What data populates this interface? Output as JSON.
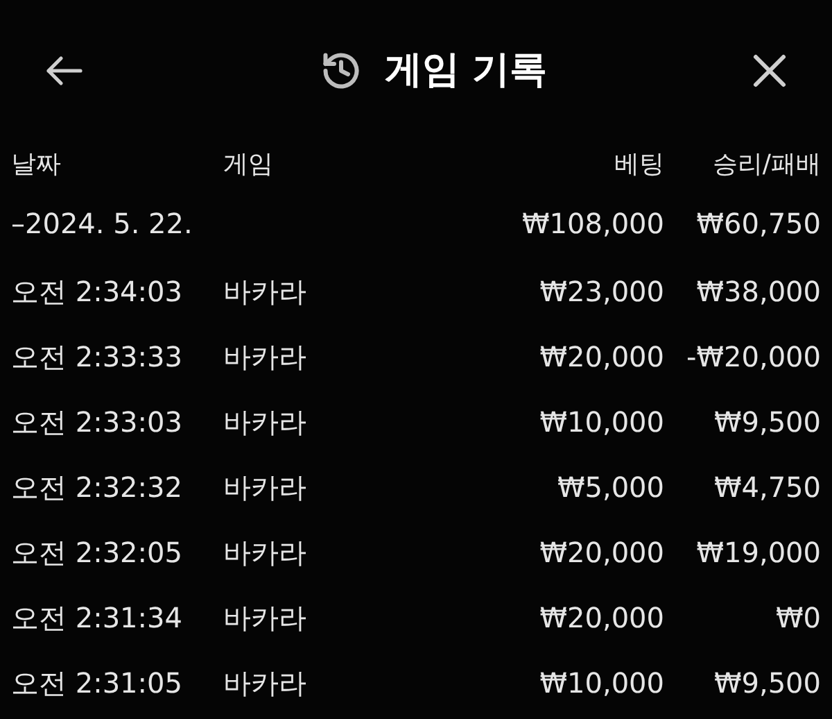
{
  "header": {
    "title": "게임 기록"
  },
  "table": {
    "columns": [
      "날짜",
      "게임",
      "베팅",
      "승리/패배"
    ],
    "summary": {
      "date": "–2024. 5. 22.",
      "bet": "₩108,000",
      "result": "₩60,750"
    },
    "rows": [
      {
        "time": "오전 2:34:03",
        "game": "바카라",
        "bet": "₩23,000",
        "result": "₩38,000"
      },
      {
        "time": "오전 2:33:33",
        "game": "바카라",
        "bet": "₩20,000",
        "result": "-₩20,000"
      },
      {
        "time": "오전 2:33:03",
        "game": "바카라",
        "bet": "₩10,000",
        "result": "₩9,500"
      },
      {
        "time": "오전 2:32:32",
        "game": "바카라",
        "bet": "₩5,000",
        "result": "₩4,750"
      },
      {
        "time": "오전 2:32:05",
        "game": "바카라",
        "bet": "₩20,000",
        "result": "₩19,000"
      },
      {
        "time": "오전 2:31:34",
        "game": "바카라",
        "bet": "₩20,000",
        "result": "₩0"
      },
      {
        "time": "오전 2:31:05",
        "game": "바카라",
        "bet": "₩10,000",
        "result": "₩9,500"
      }
    ]
  }
}
